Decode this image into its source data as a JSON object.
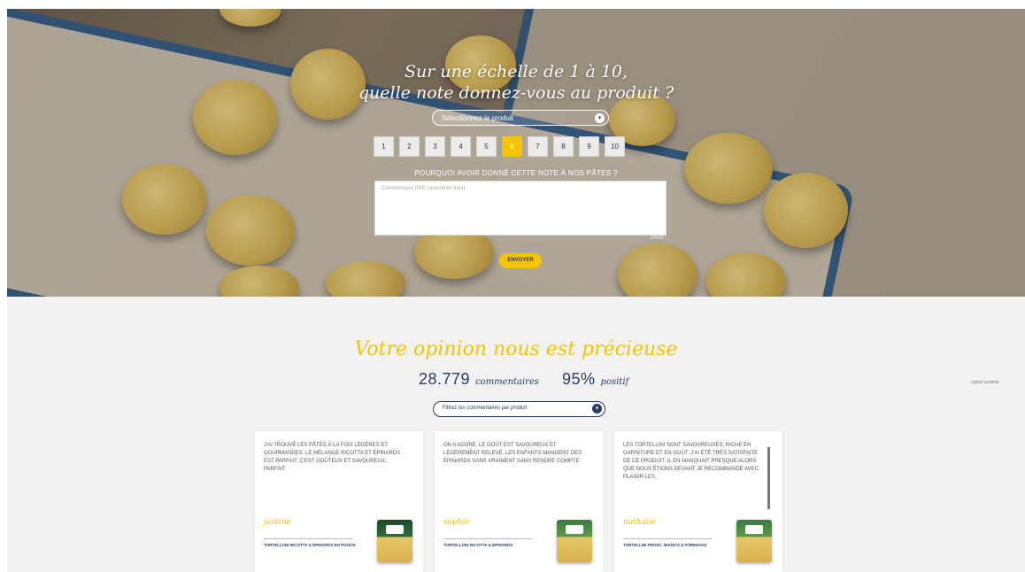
{
  "hero": {
    "title_line1": "Sur une échelle de 1 à 10,",
    "title_line2": "quelle note donnez-vous au produit ?",
    "product_select_placeholder": "Sélectionnez le produit",
    "scores": [
      "1",
      "2",
      "3",
      "4",
      "5",
      "6",
      "7",
      "8",
      "9",
      "10"
    ],
    "selected_score": "6",
    "why_label": "POURQUOI AVOIR DONNÉ CETTE NOTE À NOS PÂTES ?",
    "comment_placeholder": "Commentaire (500 caractères max)",
    "char_counter": "0/500",
    "submit_label": "ENVOYER"
  },
  "reviews": {
    "title": "Votre opinion nous est précieuse",
    "comment_count": "28.779",
    "comment_word": "commentaires",
    "positive_pct": "95%",
    "positive_word": "positif",
    "report_link": "report content",
    "filter_placeholder": "Filtrez les commentaires par produit",
    "cards": [
      {
        "text": "J'AI TROUVÉ LES PÂTES À LA FOIS LÉGÈRES ET GOURMANDES. LE MÉLANGE RICOTTA ET ÉPINARDS EST PARFAIT. C'EST GOÛTEUX ET SAVOUREUX. PARFAIT.",
        "signature": "justine",
        "product": "TORTELLONI RICOTTA & ÉPINARDS EN POUCH"
      },
      {
        "text": "ON A ADORÉ. LE GOÛT EST SAVOUREUX ET LÉGÈREMENT RELEVÉ. LES ENFANTS MANGENT DES ÉPINARDS SANS VRAIMENT SANS RENDRE COMPTE",
        "signature": "sophie",
        "product": "TORTELLONI RICOTTA & ÉPINARDS"
      },
      {
        "text": "LES TORTELLINI SONT SAVOUREUSES, RICHE EN GARNITURE ET EN GOÛT. J'AI ÉTÉ TRÈS SATISFAITE DE CE PRODUIT. IL EN MANQUAIT PRESQUE ALORS QUE NOUS ÉTIONS DEVANT JE RECOMMANDE AVEC PLAISIR LES",
        "signature": "nathalie",
        "product": "TORTELLINI PROSC. BIANCO & FORMAGGI"
      }
    ]
  }
}
